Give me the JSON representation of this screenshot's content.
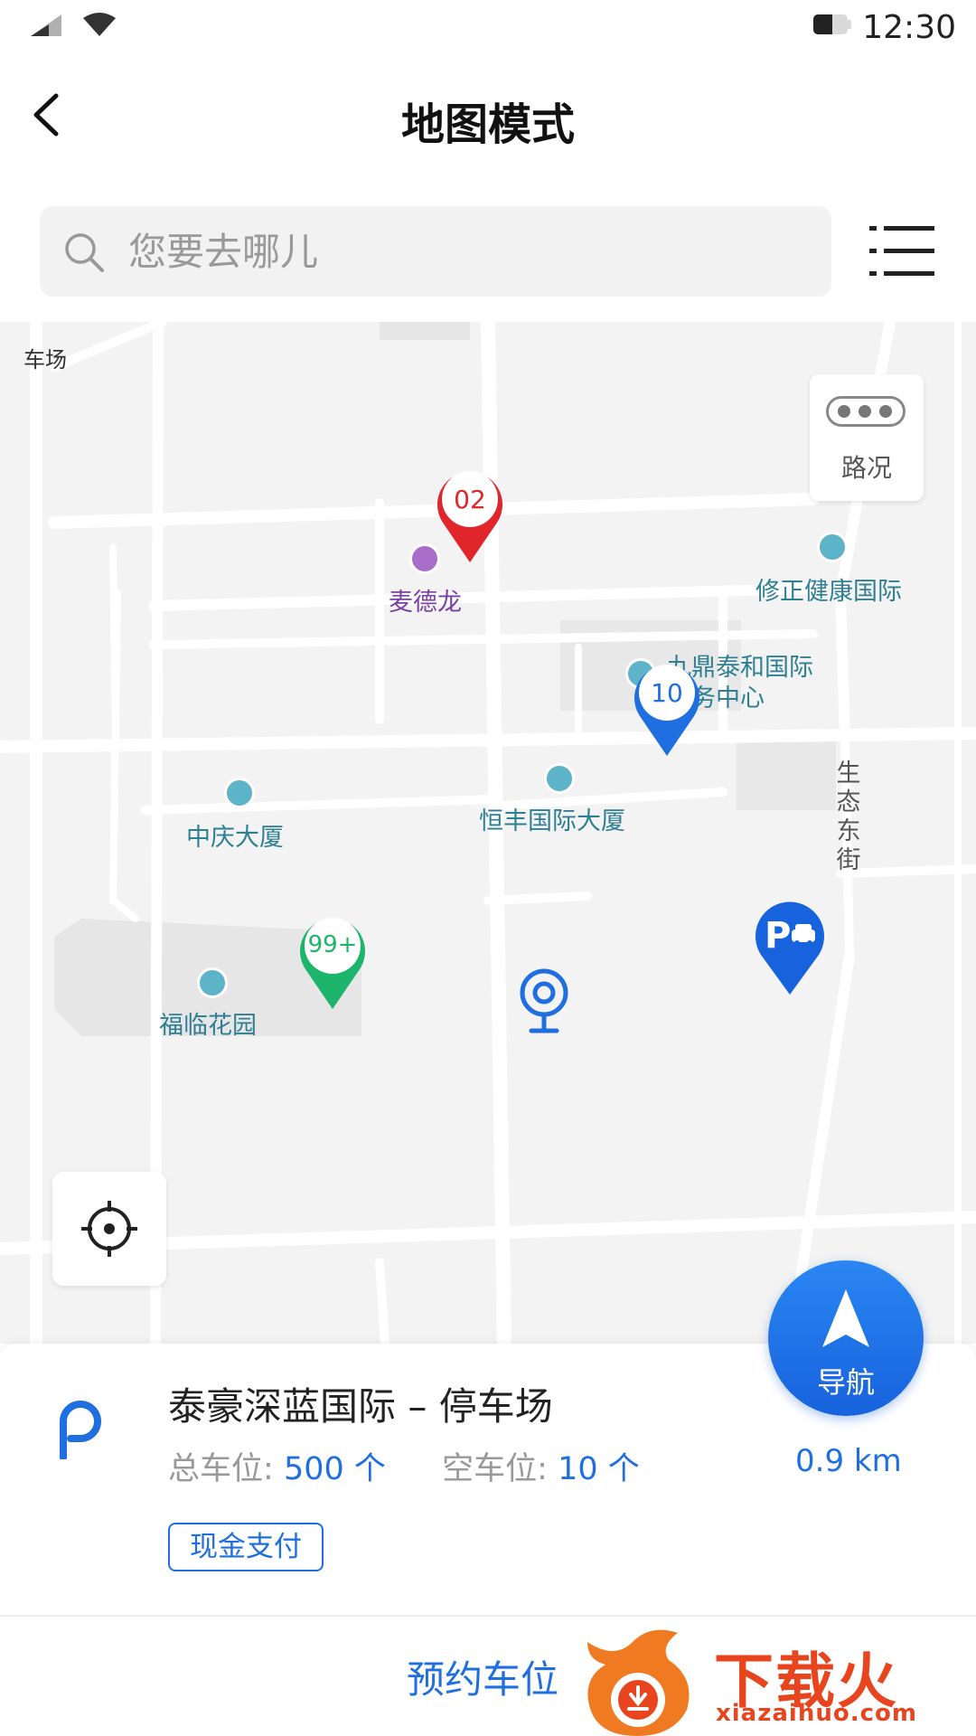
{
  "status_bar": {
    "time": "12:30",
    "battery_level": 0.55
  },
  "header": {
    "title": "地图模式"
  },
  "search": {
    "placeholder": "您要去哪儿"
  },
  "map": {
    "traffic_button": {
      "label": "路况"
    },
    "pois": [
      {
        "label": "车场"
      },
      {
        "label": "麦德龙"
      },
      {
        "label": "修正健康国际"
      },
      {
        "label": "九鼎泰和国际"
      },
      {
        "label": "商务中心"
      },
      {
        "label": "中庆大厦"
      },
      {
        "label": "恒丰国际大厦"
      },
      {
        "label": "福临花园"
      }
    ],
    "street_label": "生态东街",
    "pins": [
      {
        "label": "02",
        "color": "#e0262b"
      },
      {
        "label": "10",
        "color": "#1f6fe0"
      },
      {
        "label": "99+",
        "color": "#1cb56b"
      }
    ],
    "icons": [
      "traffic-icon",
      "current-location-icon",
      "parking-car-icon",
      "locate-icon"
    ]
  },
  "parking_card": {
    "name": "泰豪深蓝国际 – 停车场",
    "total_label": "总车位:",
    "total_value": "500 个",
    "free_label": "空车位:",
    "free_value": "10 个",
    "distance": "0.9 km",
    "payment_tag": "现金支付",
    "nav_label": "导航"
  },
  "bottom_bar": {
    "reserve_label": "预约车位"
  },
  "watermark": {
    "text": "下载火",
    "sub": "xiazaihuo.com"
  },
  "colors": {
    "accent": "#1f6fe0",
    "red_pin": "#e0262b",
    "green_pin": "#1cb56b",
    "watermark": "#e8451e"
  }
}
